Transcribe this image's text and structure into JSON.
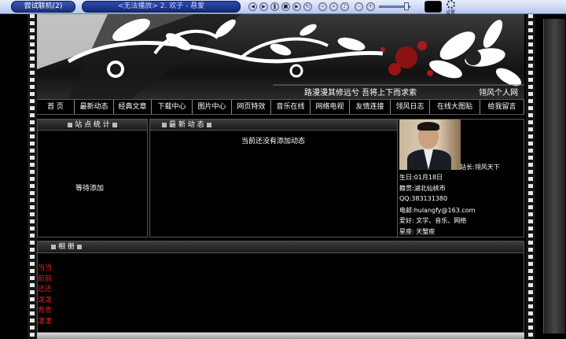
{
  "player": {
    "try_button": "尝试联机(2)",
    "now_playing": "<无法播放> 2. 欢子 - 悬爱",
    "settings_label": "设置"
  },
  "banner": {
    "slogan": "路漫漫其修远兮  吾将上下而求索",
    "site_name": "翎风个人网"
  },
  "nav": [
    {
      "label": "首  页",
      "w": 48
    },
    {
      "label": "最新动态",
      "w": 50
    },
    {
      "label": "经典文章",
      "w": 48
    },
    {
      "label": "下载中心",
      "w": 52
    },
    {
      "label": "图片中心",
      "w": 50
    },
    {
      "label": "网页特效",
      "w": 50
    },
    {
      "label": "音乐在线",
      "w": 50
    },
    {
      "label": "网络电视",
      "w": 50
    },
    {
      "label": "友情连接",
      "w": 52
    },
    {
      "label": "翎风日志",
      "w": 50
    },
    {
      "label": "在线大图贴",
      "w": 64
    },
    {
      "label": "给我留言",
      "w": 56
    }
  ],
  "stats_panel": {
    "title": "站 点 统 计",
    "placeholder": "等待添加"
  },
  "news_panel": {
    "title": "最 新 动 态",
    "empty_text": "当前还没有添加动态"
  },
  "profile": {
    "owner": "站长:翎风天下",
    "birthday": "生日:01月18日",
    "hometown": "籍贯:湖北仙桃市",
    "qq": "QQ:383131380",
    "email": "电邮:hulangfy@163.com",
    "hobbies": "爱好: 文学、音乐、网络",
    "zodiac": "星座: 天蟹座"
  },
  "album_panel": {
    "title": "相 册",
    "items": [
      "当当",
      "前前",
      "还还",
      "泼泼",
      "青青",
      "凄凄"
    ]
  },
  "colors": {
    "accent_red": "#e02020",
    "player_blue": "#1a2f7c"
  }
}
